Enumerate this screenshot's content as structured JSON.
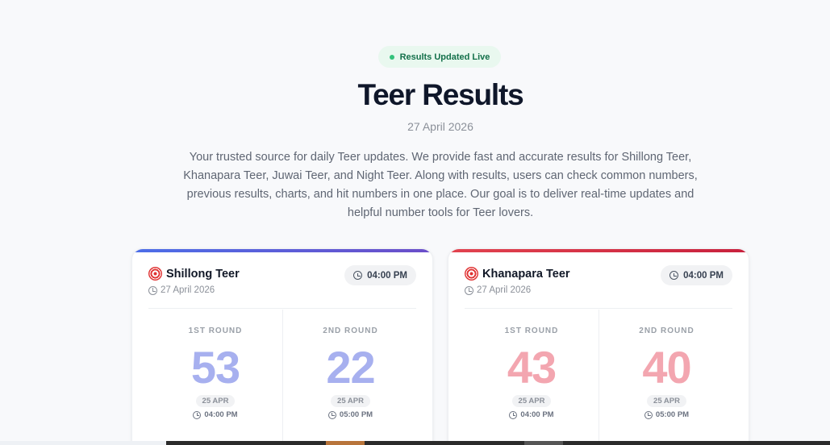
{
  "badge": {
    "label": "Results Updated Live"
  },
  "header": {
    "title": "Teer Results",
    "date": "27 April 2026",
    "intro": "Your trusted source for daily Teer updates. We provide fast and accurate results for Shillong Teer, Khanapara Teer, Juwai Teer, and Night Teer. Along with results, users can check common numbers, previous results, charts, and hit numbers in one place. Our goal is to deliver real-time updates and helpful number tools for Teer lovers."
  },
  "cards": [
    {
      "name": "Shillong Teer",
      "date": "27 April 2026",
      "time": "04:00 PM",
      "accent": "#4c6ee8",
      "rounds": [
        {
          "label": "1ST ROUND",
          "number": "53",
          "day": "25 APR",
          "time": "04:00 PM"
        },
        {
          "label": "2ND ROUND",
          "number": "22",
          "day": "25 APR",
          "time": "05:00 PM"
        }
      ]
    },
    {
      "name": "Khanapara Teer",
      "date": "27 April 2026",
      "time": "04:00 PM",
      "accent": "#e2434f",
      "rounds": [
        {
          "label": "1ST ROUND",
          "number": "43",
          "day": "25 APR",
          "time": "04:00 PM"
        },
        {
          "label": "2ND ROUND",
          "number": "40",
          "day": "25 APR",
          "time": "05:00 PM"
        }
      ]
    }
  ]
}
